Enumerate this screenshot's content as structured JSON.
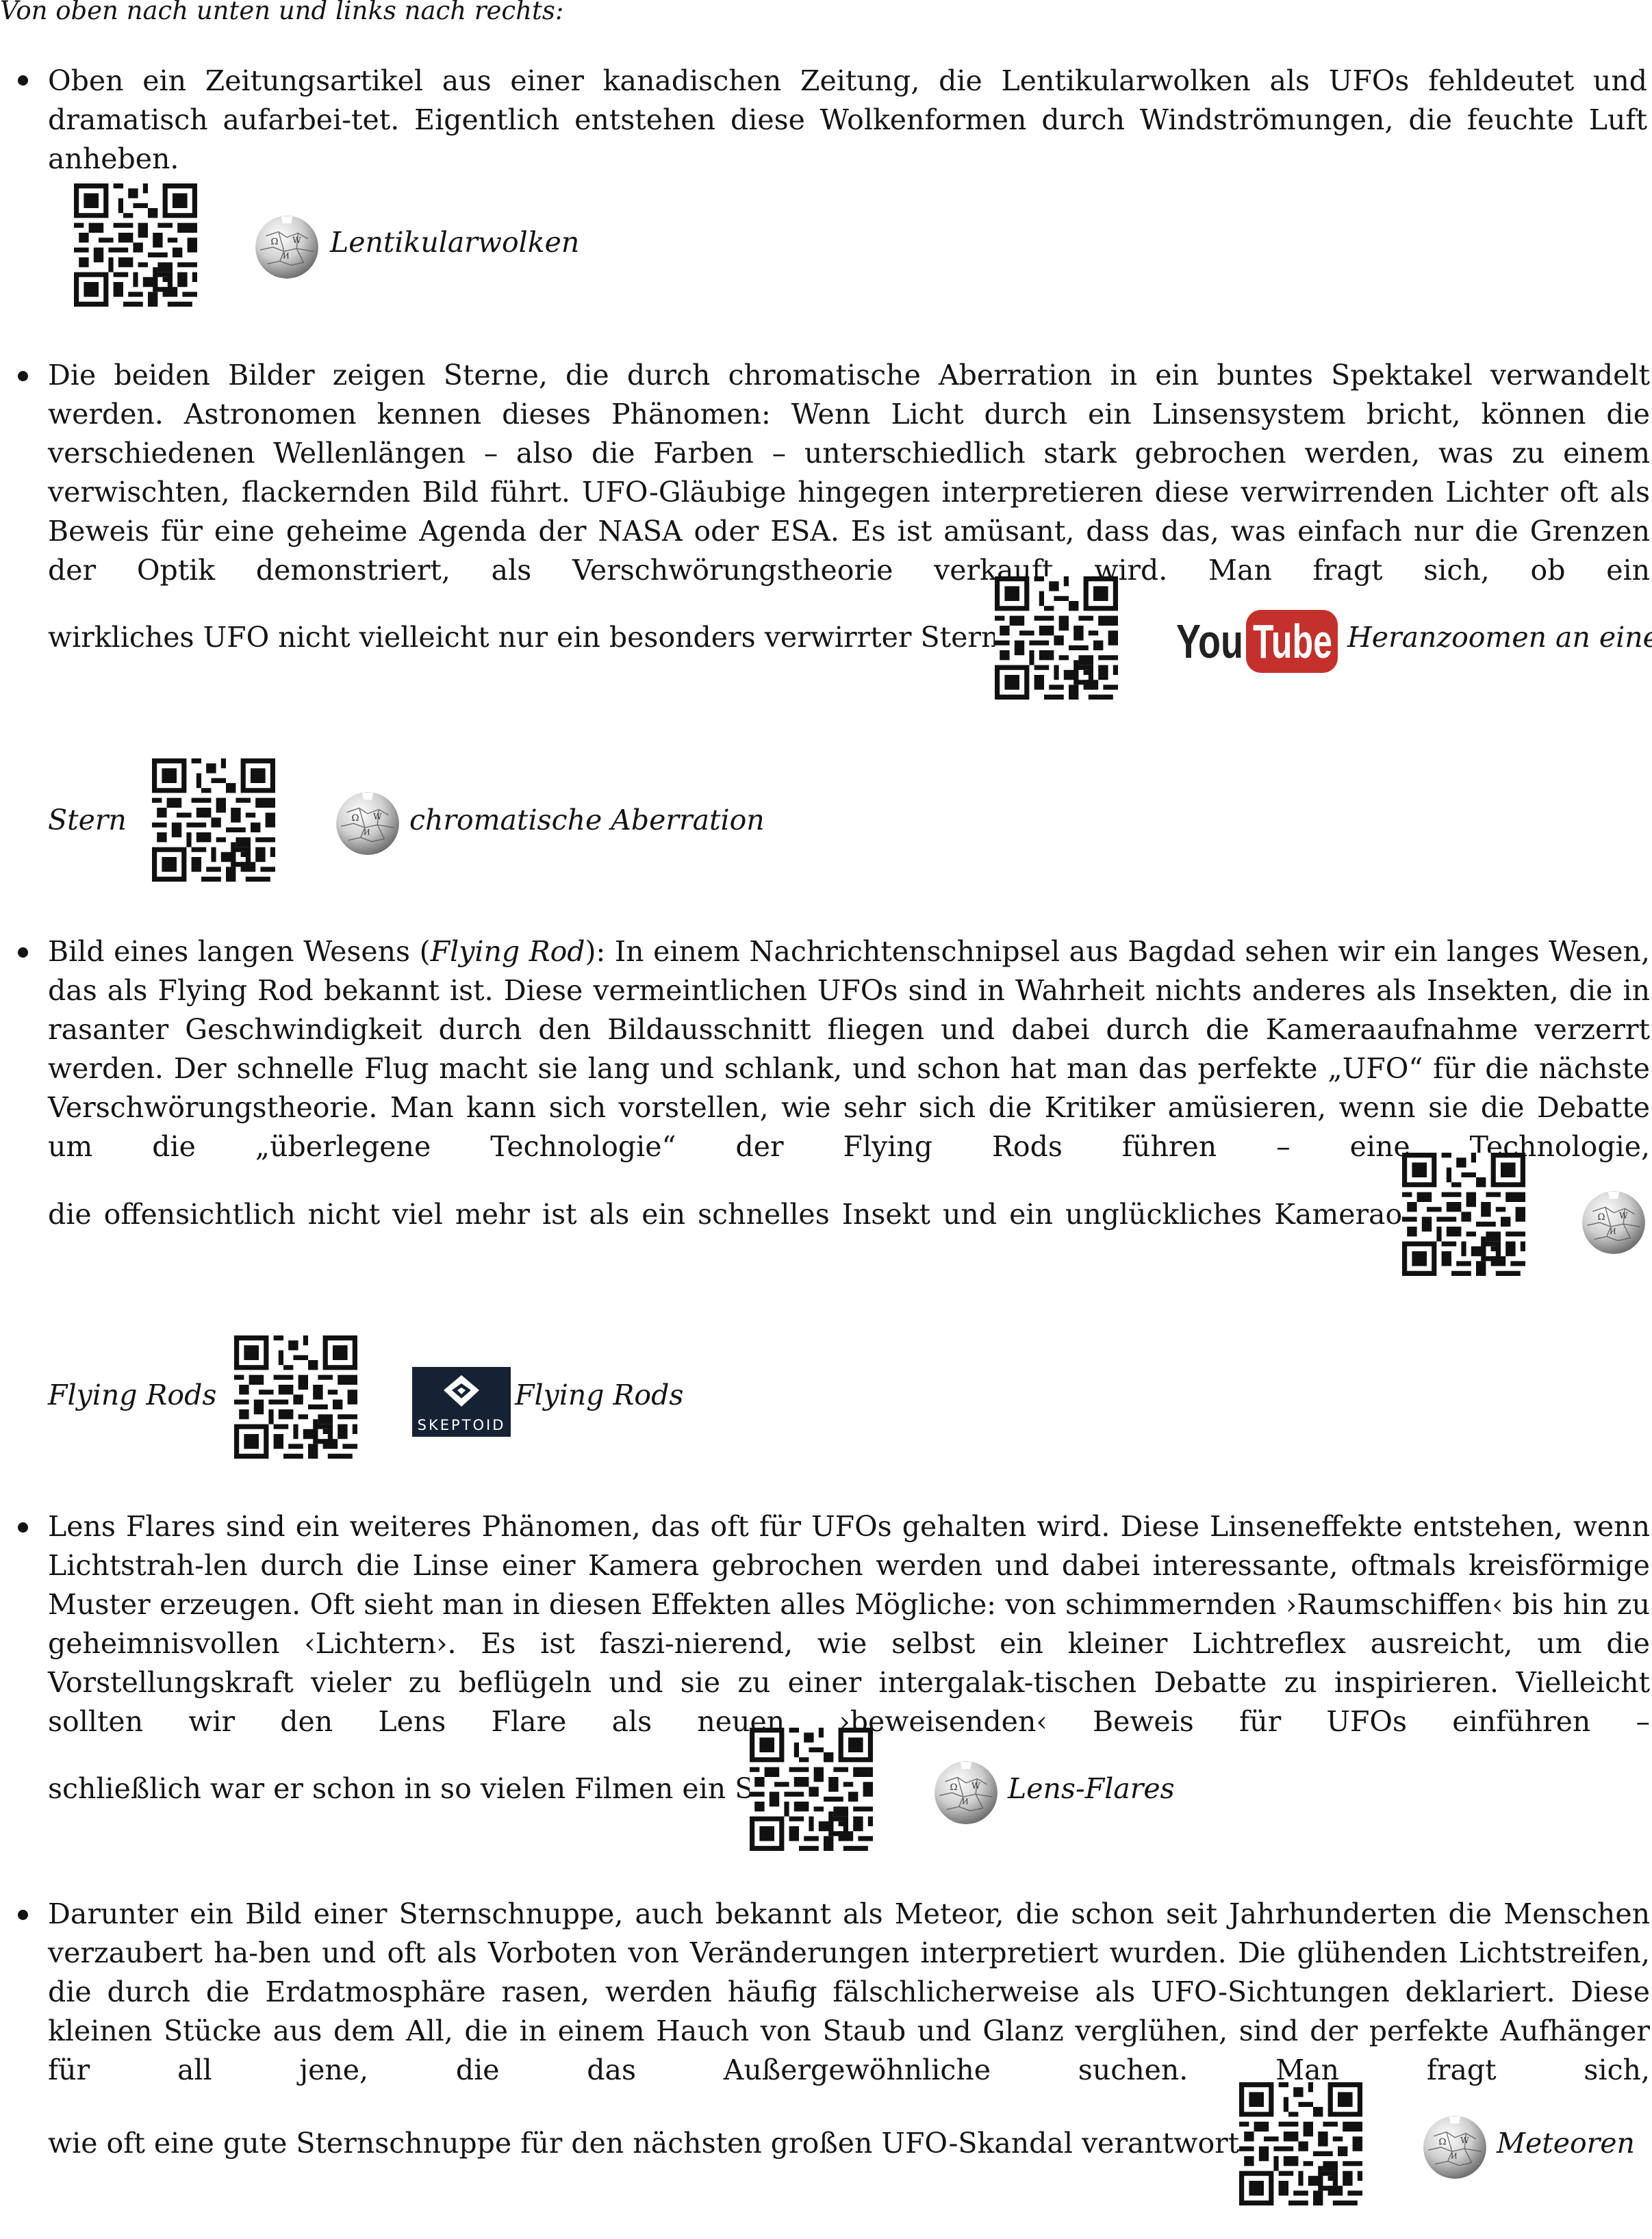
{
  "intro": "Von oben nach unten und links nach rechts:",
  "items": [
    {
      "text": "Oben ein Zeitungsartikel aus einer kanadischen Zeitung, die Lentikularwolken als UFOs fehldeutet und dramatisch aufarbei-tet. Eigentlich entstehen diese Wolkenformen durch Windströmungen, die feuchte Luft anheben.",
      "refs": [
        {
          "icon": "wikipedia-icon",
          "label": "Lentikularwolken"
        }
      ]
    },
    {
      "text": "Die beiden Bilder zeigen Sterne, die durch chromatische Aberration in ein buntes Spektakel verwandelt werden. Astronomen kennen dieses Phänomen: Wenn Licht durch ein Linsensystem bricht, können die verschiedenen Wellenlängen – also die Farben – unterschiedlich stark gebrochen werden, was zu einem verwischten, flackernden Bild führt. UFO-Gläubige hingegen interpretieren diese verwirrenden Lichter oft als Beweis für eine geheime Agenda der NASA oder ESA. Es ist amüsant, dass das, was einfach nur die Grenzen der Optik demonstriert, als Verschwörungstheorie verkauft wird. Man fragt sich, ob ein",
      "tail": "wirkliches UFO nicht vielleicht nur ein besonders verwirrter Stern ist!",
      "refs": [
        {
          "icon": "youtube-logo",
          "label_part1": "Heranzoomen an einen",
          "label_part2": "Stern",
          "logo_text": "YouTube"
        },
        {
          "icon": "wikipedia-icon",
          "label": "chromatische Aberration"
        }
      ]
    },
    {
      "text_before": "Bild eines langen Wesens (",
      "text_italic": "Flying Rod",
      "text": "): In einem Nachrichtenschnipsel aus Bagdad sehen wir ein langes Wesen, das als Flying Rod bekannt ist. Diese vermeintlichen UFOs sind in Wahrheit nichts anderes als Insekten, die in rasanter Geschwindigkeit durch den Bildausschnitt fliegen und dabei durch die Kameraaufnahme verzerrt werden. Der schnelle Flug macht sie lang und schlank, und schon hat man das perfekte „UFO“ für die nächste Verschwörungstheorie. Man kann sich vorstellen, wie sehr sich die Kritiker amüsieren, wenn sie die Debatte um die „überlegene Technologie“ der Flying Rods führen – eine Technologie,",
      "tail": "die offensichtlich nicht viel mehr ist als ein schnelles Insekt und ein unglückliches Kameraobjektiv.",
      "refs": [
        {
          "icon": "wikipedia-icon",
          "label": "Flying Rods"
        },
        {
          "icon": "skeptoid-logo",
          "label": "Flying Rods",
          "logo_text": "SKEPTOID"
        }
      ]
    },
    {
      "text": "Lens Flares sind ein weiteres Phänomen, das oft für UFOs gehalten wird. Diese Linseneffekte entstehen, wenn Lichtstrah-len durch die Linse einer Kamera gebrochen werden und dabei interessante, oftmals kreisförmige Muster erzeugen. Oft sieht man in diesen Effekten alles Mögliche: von schimmernden ›Raumschiffen‹ bis hin zu geheimnisvollen ‹Lichtern›. Es ist faszi-nierend, wie selbst ein kleiner Lichtreflex ausreicht, um die Vorstellungskraft vieler zu beflügeln und sie zu einer intergalak-tischen Debatte zu inspirieren. Vielleicht sollten wir den Lens Flare als neuen, ›beweisenden‹ Beweis für UFOs einführen –",
      "tail": "schließlich war er schon in so vielen Filmen ein Star!",
      "refs": [
        {
          "icon": "wikipedia-icon",
          "label": "Lens-Flares"
        }
      ]
    },
    {
      "text": "Darunter ein Bild einer Sternschnuppe, auch bekannt als Meteor, die schon seit Jahrhunderten die Menschen verzaubert ha-ben und oft als Vorboten von Veränderungen interpretiert wurden. Die glühenden Lichtstreifen, die durch die Erdatmosphäre rasen, werden häufig fälschlicherweise als UFO-Sichtungen deklariert. Diese kleinen Stücke aus dem All, die in einem Hauch von Staub und Glanz verglühen, sind der perfekte Aufhänger für all jene, die das Außergewöhnliche suchen. Man fragt sich,",
      "tail": "wie oft eine gute Sternschnuppe für den nächsten großen UFO-Skandal verantwortlich ist.",
      "refs": [
        {
          "icon": "wikipedia-icon",
          "label": "Meteoren"
        }
      ]
    }
  ],
  "colors": {
    "text": "#141414",
    "youtube_red": "#c4302b"
  }
}
